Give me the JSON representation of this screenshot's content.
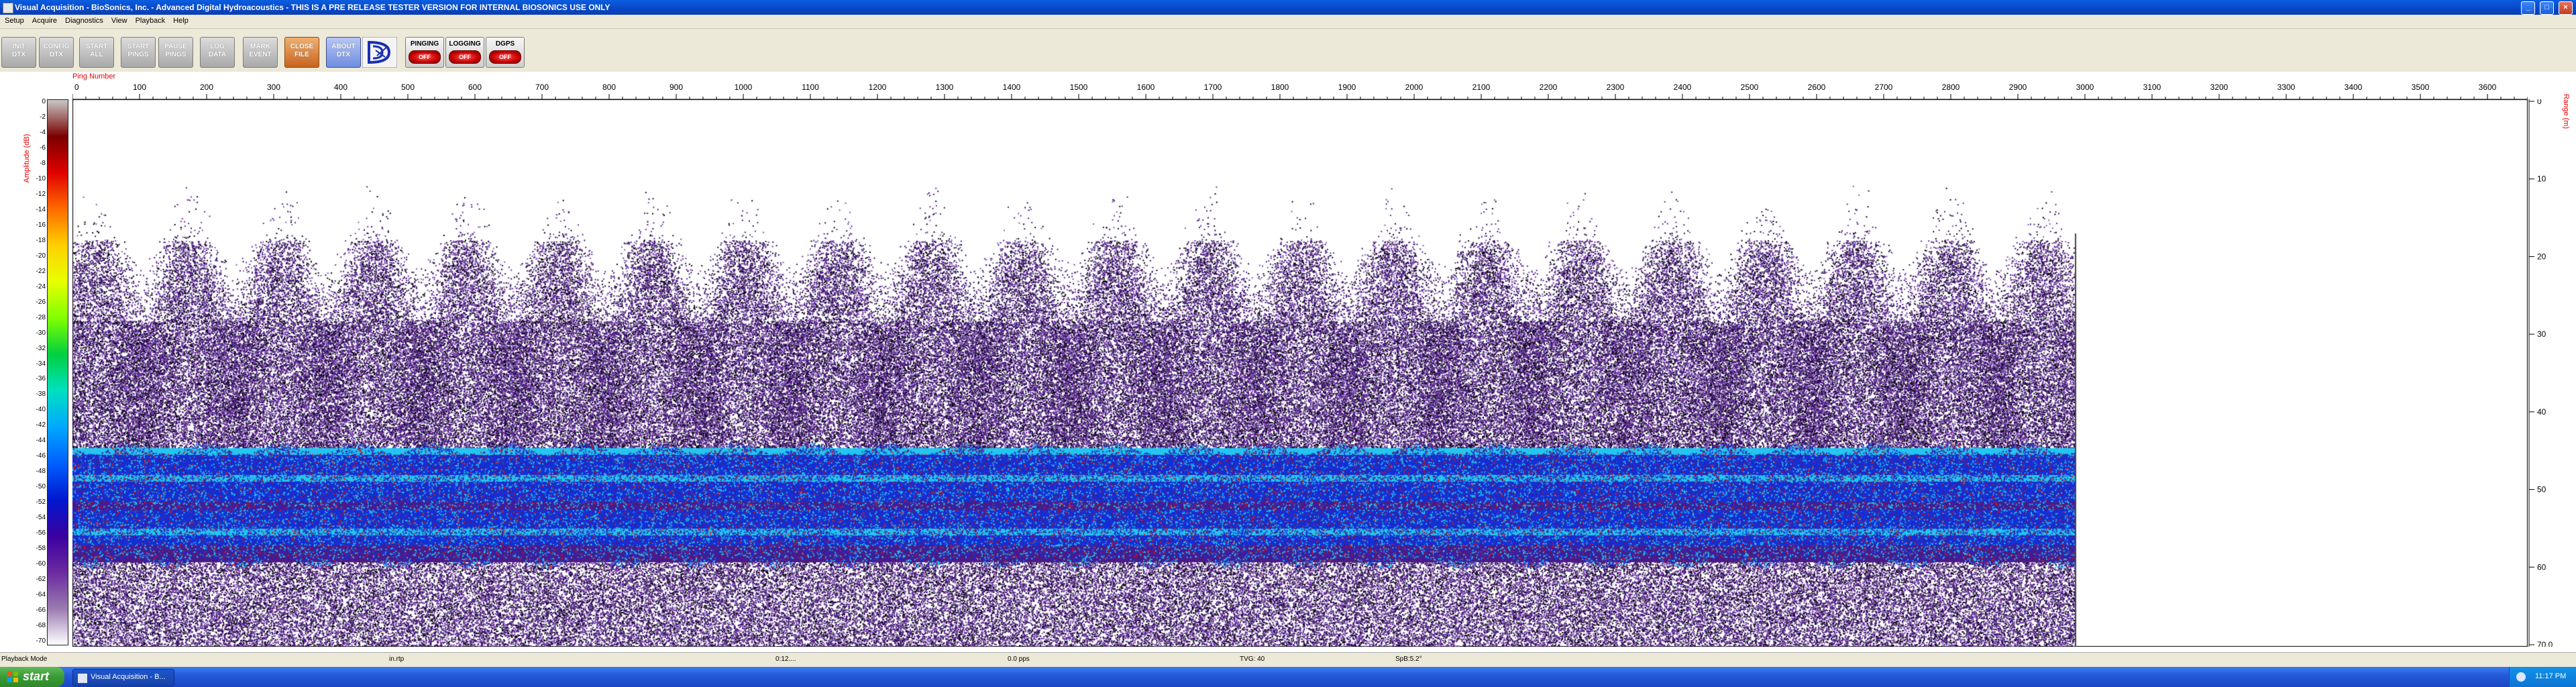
{
  "window": {
    "title": "Visual Acquisition - BioSonics, Inc. - Advanced Digital Hydroacoustics - THIS IS A PRE RELEASE TESTER VERSION FOR INTERNAL BIOSONICS USE ONLY",
    "minimize": "_",
    "maximize": "□",
    "close": "×"
  },
  "menu": [
    "Setup",
    "Acquire",
    "Diagnostics",
    "View",
    "Playback",
    "Help"
  ],
  "toolbar": {
    "buttons": [
      {
        "l1": "INIT",
        "l2": "DTX"
      },
      {
        "l1": "CONFIG",
        "l2": "DTX"
      },
      {
        "l1": "START",
        "l2": "ALL"
      },
      {
        "l1": "START",
        "l2": "PINGS"
      },
      {
        "l1": "PAUSE",
        "l2": "PINGS"
      },
      {
        "l1": "LOG",
        "l2": "DATA"
      },
      {
        "l1": "MARK",
        "l2": "EVENT"
      },
      {
        "l1": "CLOSE",
        "l2": "FILE"
      },
      {
        "l1": "ABOUT",
        "l2": "DTX"
      }
    ],
    "toggles": [
      {
        "label": "PINGING",
        "state": "OFF"
      },
      {
        "label": "LOGGING",
        "state": "OFF"
      },
      {
        "label": "DGPS",
        "state": "OFF"
      }
    ]
  },
  "plot": {
    "top_axis_label": "Ping Number",
    "left_axis_label": "Amplitude (dB)",
    "right_axis_label": "Range (m)",
    "ping_ticks": [
      "100",
      "200",
      "300",
      "400",
      "500",
      "600",
      "700",
      "800",
      "900",
      "1000",
      "1100",
      "1200",
      "1300",
      "1400",
      "1500",
      "1600",
      "1700",
      "1800",
      "1900",
      "2000",
      "2100",
      "2200",
      "2300",
      "2400",
      "2500",
      "2600",
      "2700",
      "2800",
      "2900",
      "3000",
      "3100",
      "3200",
      "3300",
      "3400",
      "3500",
      "3600"
    ],
    "ping_zero": "0",
    "ping_min": 0,
    "ping_max": 3660,
    "data_end_ping": 2985,
    "amplitude_ticks": [
      "0",
      "-2",
      "-4",
      "-6",
      "-8",
      "-10",
      "-12",
      "-14",
      "-16",
      "-18",
      "-20",
      "-22",
      "-24",
      "-26",
      "-28",
      "-30",
      "-32",
      "-34",
      "-36",
      "-38",
      "-40",
      "-42",
      "-44",
      "-46",
      "-48",
      "-50",
      "-52",
      "-54",
      "-56",
      "-58",
      "-60",
      "-62",
      "-64",
      "-66",
      "-68",
      "-70"
    ],
    "range_ticks": [
      "0",
      "10",
      "20",
      "30",
      "40",
      "50",
      "60",
      "70.0"
    ],
    "range_max_m": 70,
    "colors": {
      "axis_label": "#e00000",
      "echo_purple": "#4b1a88",
      "echo_blue": "#1230d8",
      "echo_cyan": "#23c6f0",
      "echo_red": "#d01818"
    }
  },
  "status": {
    "mode": "Playback Mode",
    "f2": "in.rtp",
    "f3": "0:12....",
    "f4": "0.0 pps",
    "f5": "TVG: 40",
    "f6": "SpB:5.2°"
  },
  "taskbar": {
    "start": "start",
    "item": "Visual Acquisition - B...",
    "clock": "11:17 PM"
  }
}
